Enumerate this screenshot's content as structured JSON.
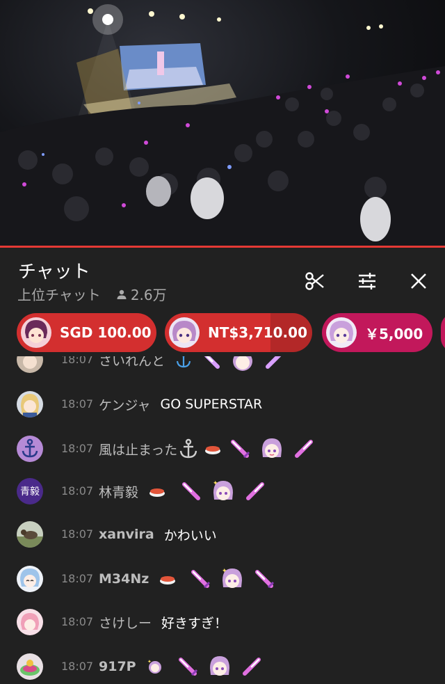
{
  "video": {
    "progress_percent": 100
  },
  "chat": {
    "title": "チャット",
    "mode": "上位チャット",
    "viewers": "2.6万",
    "header_icons": [
      "scissors-icon",
      "tune-icon",
      "close-icon"
    ]
  },
  "superchats": [
    {
      "amount": "SGD 100.00",
      "color": "#d32f2f",
      "dark": "#b71c1c"
    },
    {
      "amount": "NT$3,710.00",
      "color": "#d32f2f",
      "dark": "#b71c1c"
    },
    {
      "amount": "￥5,000",
      "color": "#c2185b",
      "dark": "#a31349"
    }
  ],
  "messages": [
    {
      "time": "18:07",
      "author": "さいれんと",
      "text": ""
    },
    {
      "time": "18:07",
      "author": "ケンジャ",
      "text": "GO SUPERSTAR"
    },
    {
      "time": "18:07",
      "author": "風は止まった",
      "text": ""
    },
    {
      "time": "18:07",
      "author": "林青毅",
      "text": "",
      "avatar_text": "青毅"
    },
    {
      "time": "18:07",
      "author": "xanvira",
      "text": "かわいい"
    },
    {
      "time": "18:07",
      "author": "M34Nz",
      "text": ""
    },
    {
      "time": "18:07",
      "author": "さけしー",
      "text": "好きすぎ！"
    },
    {
      "time": "18:07",
      "author": "917P",
      "text": ""
    }
  ]
}
